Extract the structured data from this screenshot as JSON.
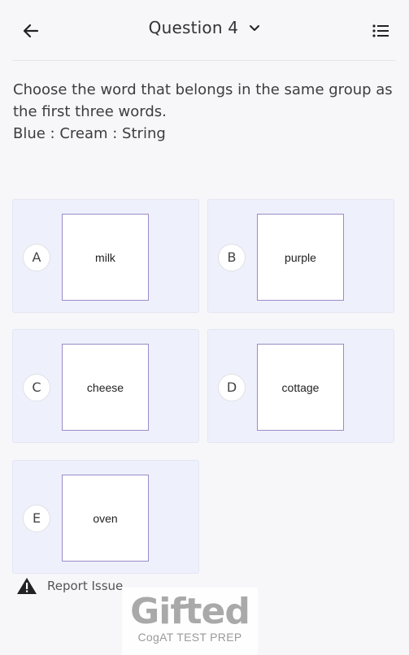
{
  "header": {
    "title": "Question 4",
    "back_icon": "arrow-left-icon",
    "dropdown_icon": "chevron-down-icon",
    "list_icon": "list-icon"
  },
  "question": {
    "prompt": "Choose the word that belongs in the same group as the first three words.",
    "words": "Blue : Cream : String"
  },
  "options": [
    {
      "letter": "A",
      "word": "milk"
    },
    {
      "letter": "B",
      "word": "purple"
    },
    {
      "letter": "C",
      "word": "cheese"
    },
    {
      "letter": "D",
      "word": "cottage"
    },
    {
      "letter": "E",
      "word": "oven"
    }
  ],
  "report": {
    "label": "Report Issue",
    "icon": "warning-icon"
  },
  "watermark": {
    "logo": "Gifted",
    "subtitle": "CogAT TEST PREP"
  },
  "colors": {
    "background": "#f7f7fa",
    "option_background": "#eef0fb",
    "word_box_border": "#9a8cc9"
  }
}
